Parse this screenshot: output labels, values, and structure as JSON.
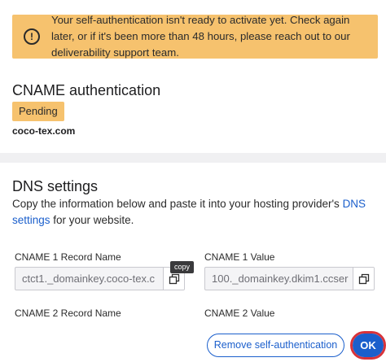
{
  "alert": {
    "icon": "warning-circle-icon",
    "text": "Your self-authentication isn't ready to activate yet. Check again later, or if it's been more than 48 hours, please reach out to our deliverability support team."
  },
  "cname": {
    "title": "CNAME authentication",
    "status": "Pending",
    "domain": "coco-tex.com"
  },
  "dns": {
    "title": "DNS settings",
    "desc_prefix": "Copy the information below and paste it into your hosting provider's ",
    "desc_link": "DNS settings",
    "desc_suffix": " for your website.",
    "fields": [
      {
        "label": "CNAME 1 Record Name",
        "value": "ctct1._domainkey.coco-tex.c"
      },
      {
        "label": "CNAME 1 Value",
        "value": "100._domainkey.dkim1.ccser"
      },
      {
        "label": "CNAME 2 Record Name",
        "value": ""
      },
      {
        "label": "CNAME 2 Value",
        "value": ""
      }
    ],
    "copy_tooltip": "copy"
  },
  "footer": {
    "remove_label": "Remove self-authentication",
    "ok_label": "OK"
  },
  "colors": {
    "alert_bg": "#f6c26e",
    "primary": "#1b5fcc",
    "highlight": "#d8333a"
  }
}
